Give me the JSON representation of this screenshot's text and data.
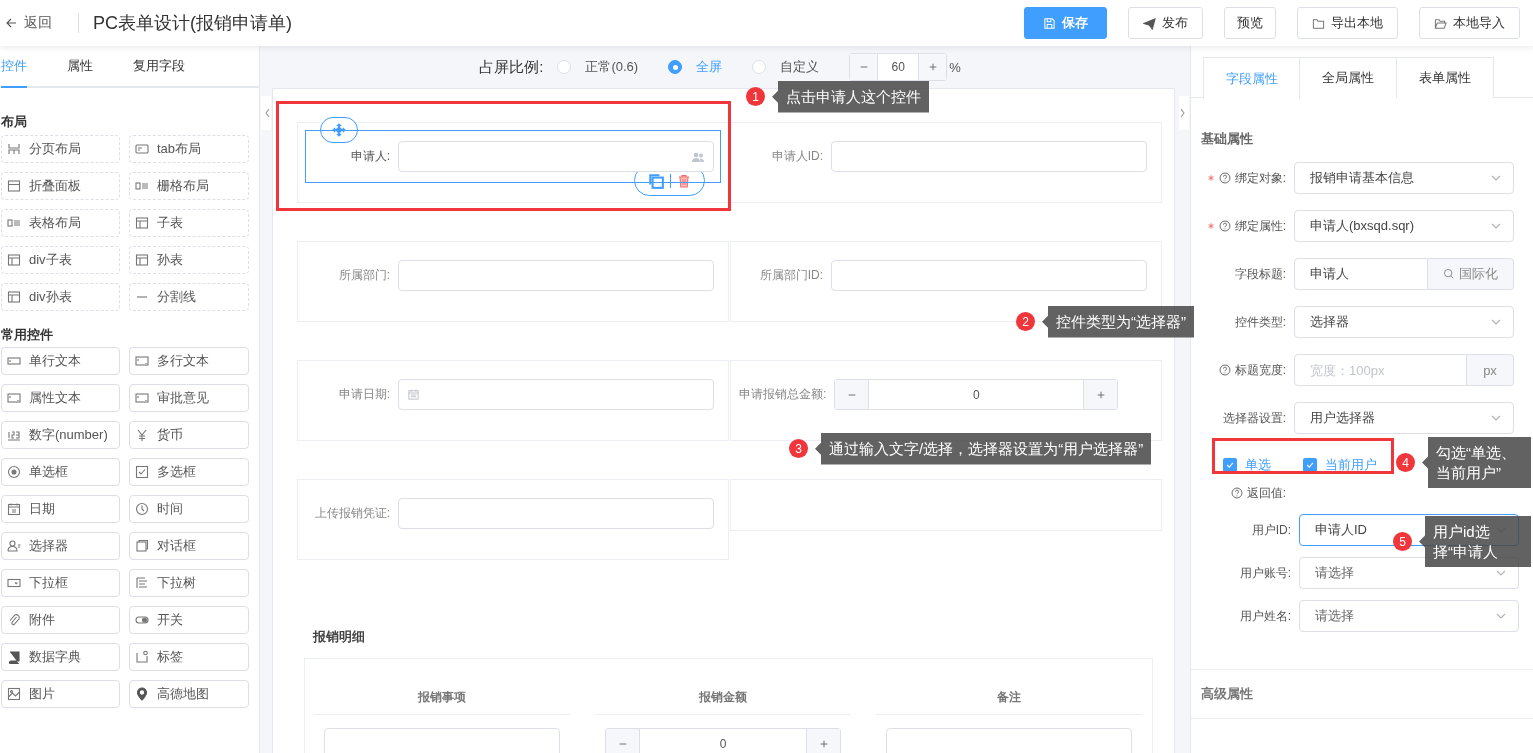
{
  "header": {
    "back": "返回",
    "title": "PC表单设计(报销申请单)",
    "buttons": [
      {
        "label": "保存",
        "kind": "save"
      },
      {
        "label": "发布",
        "kind": "publish"
      },
      {
        "label": "预览",
        "kind": "plain"
      },
      {
        "label": "导出本地",
        "kind": "export"
      },
      {
        "label": "本地导入",
        "kind": "import"
      }
    ]
  },
  "left_panel": {
    "tabs": [
      {
        "label": "控件",
        "selected": true
      },
      {
        "label": "属性",
        "selected": false
      },
      {
        "label": "复用字段",
        "selected": false
      }
    ],
    "sections": [
      {
        "title": "布局",
        "kind": "layout",
        "items": [
          {
            "label": "分页布局",
            "kind": "pager"
          },
          {
            "label": "tab布局",
            "kind": "tab"
          },
          {
            "label": "折叠面板",
            "kind": "collapse"
          },
          {
            "label": "栅格布局",
            "kind": "grid"
          },
          {
            "label": "表格布局",
            "kind": "grid"
          },
          {
            "label": "子表",
            "kind": "table"
          },
          {
            "label": "div子表",
            "kind": "table"
          },
          {
            "label": "孙表",
            "kind": "table"
          },
          {
            "label": "div孙表",
            "kind": "table"
          },
          {
            "label": "分割线",
            "kind": "line"
          }
        ]
      },
      {
        "title": "常用控件",
        "kind": "control",
        "items": [
          {
            "label": "单行文本",
            "kind": "input"
          },
          {
            "label": "多行文本",
            "kind": "textarea"
          },
          {
            "label": "属性文本",
            "kind": "textarea"
          },
          {
            "label": "审批意见",
            "kind": "textarea"
          },
          {
            "label": "数字(number)",
            "kind": "number"
          },
          {
            "label": "货币",
            "kind": "currency"
          },
          {
            "label": "单选框",
            "kind": "radio"
          },
          {
            "label": "多选框",
            "kind": "checkbox"
          },
          {
            "label": "日期",
            "kind": "date"
          },
          {
            "label": "时间",
            "kind": "time"
          },
          {
            "label": "选择器",
            "kind": "user"
          },
          {
            "label": "对话框",
            "kind": "dialog"
          },
          {
            "label": "下拉框",
            "kind": "dropdown"
          },
          {
            "label": "下拉树",
            "kind": "tree"
          },
          {
            "label": "附件",
            "kind": "attach"
          },
          {
            "label": "开关",
            "kind": "switch"
          },
          {
            "label": "数据字典",
            "kind": "book"
          },
          {
            "label": "标签",
            "kind": "tag"
          },
          {
            "label": "图片",
            "kind": "image"
          },
          {
            "label": "高德地图",
            "kind": "map"
          }
        ]
      }
    ]
  },
  "ratio": {
    "label": "占屏比例:",
    "options": [
      {
        "label": "正常(0.6)",
        "selected": false
      },
      {
        "label": "全屏",
        "selected": true
      },
      {
        "label": "自定义",
        "selected": false
      }
    ],
    "value": "60",
    "unit": "%"
  },
  "form": {
    "rows": [
      {
        "cells": [
          {
            "label": "申请人:",
            "kind": "user",
            "selected": true
          },
          {
            "label": "申请人ID:",
            "kind": "text",
            "selected": false
          }
        ]
      },
      {
        "cells": [
          {
            "label": "所属部门:",
            "kind": "text",
            "selected": false
          },
          {
            "label": "所属部门ID:",
            "kind": "text",
            "selected": false
          }
        ]
      },
      {
        "cells": [
          {
            "label": "申请日期:",
            "kind": "date",
            "selected": false
          },
          {
            "label": "申请报销总金额:",
            "kind": "number",
            "value": "0",
            "selected": false
          }
        ]
      },
      {
        "cells": [
          {
            "label": "上传报销凭证:",
            "kind": "text",
            "selected": false
          },
          {
            "kind": "empty",
            "selected": false
          }
        ]
      }
    ],
    "detail": {
      "title": "报销明细",
      "columns": [
        "报销事项",
        "报销金额",
        "备注"
      ],
      "row": [
        {
          "kind": "text"
        },
        {
          "kind": "number",
          "value": "0"
        },
        {
          "kind": "text"
        }
      ]
    }
  },
  "right_panel": {
    "tabs": [
      {
        "label": "字段属性",
        "selected": true
      },
      {
        "label": "全局属性",
        "selected": false
      },
      {
        "label": "表单属性",
        "selected": false
      }
    ],
    "section": "基础属性",
    "fields": [
      {
        "kind": "select",
        "label": "绑定对象:",
        "required": true,
        "help": true,
        "value": "报销申请基本信息"
      },
      {
        "kind": "select",
        "label": "绑定属性:",
        "required": true,
        "help": true,
        "value": "申请人(bxsqd.sqr)"
      },
      {
        "kind": "addon",
        "label": "字段标题:",
        "required": false,
        "help": false,
        "value": "申请人",
        "addon": "国际化"
      },
      {
        "kind": "select",
        "label": "控件类型:",
        "required": false,
        "help": false,
        "value": "选择器"
      },
      {
        "kind": "suffix",
        "label": "标题宽度:",
        "required": false,
        "help": true,
        "placeholder": "宽度：100px",
        "suffix": "px"
      },
      {
        "kind": "select",
        "label": "选择器设置:",
        "required": false,
        "help": false,
        "value": "用户选择器"
      },
      {
        "kind": "checks",
        "options": [
          {
            "label": "单选",
            "checked": true
          },
          {
            "label": "当前用户",
            "checked": true
          }
        ]
      },
      {
        "kind": "note",
        "label": "返回值:",
        "required": false,
        "help": true
      },
      {
        "kind": "select",
        "label": "用户ID:",
        "required": false,
        "help": false,
        "value": "申请人ID",
        "focused": true
      },
      {
        "kind": "select",
        "label": "用户账号:",
        "required": false,
        "help": false,
        "placeholder": "请选择",
        "focused": false
      },
      {
        "kind": "select",
        "label": "用户姓名:",
        "required": false,
        "help": false,
        "placeholder": "请选择",
        "focused": false
      }
    ],
    "advanced": "高级属性"
  },
  "annotations": [
    {
      "number": "1",
      "text": "点击申请人这个控件"
    },
    {
      "number": "2",
      "text": "控件类型为“选择器”"
    },
    {
      "number": "3",
      "text": "通过输入文字/选择，选择器设置为“用户选择器”"
    },
    {
      "number": "4",
      "text": "勾选“单选、当前用户”"
    },
    {
      "number": "5",
      "text": "用户id选择“申请人"
    }
  ]
}
